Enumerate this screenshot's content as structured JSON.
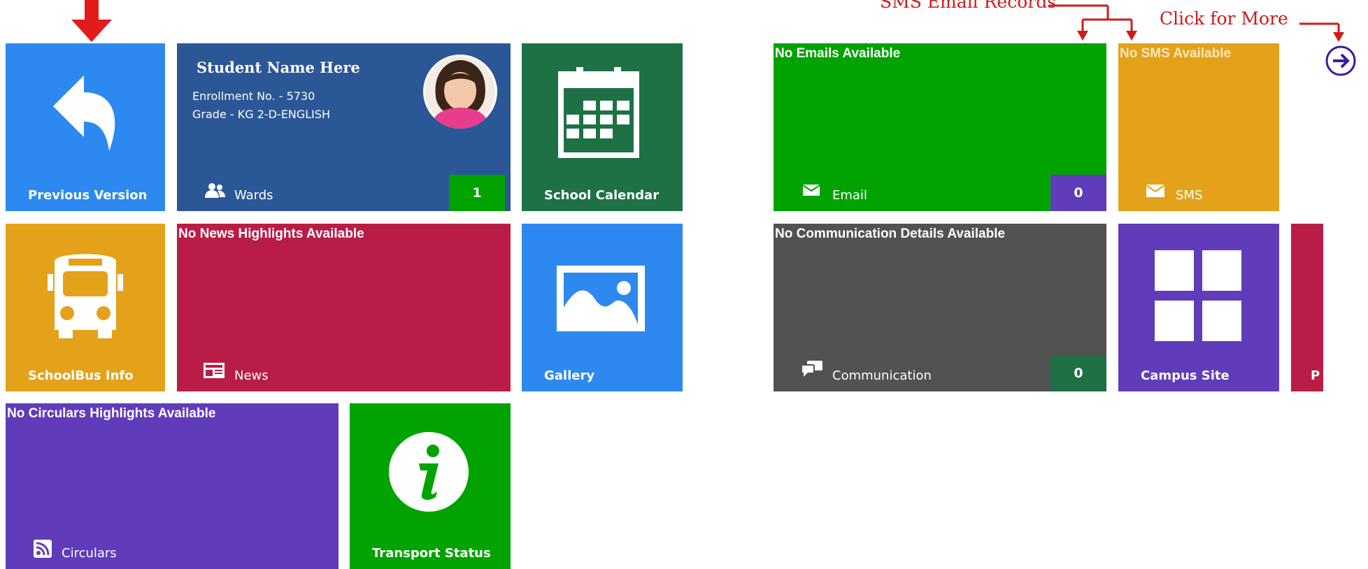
{
  "annotations": {
    "sms_email_records": "SMS Email Records",
    "click_for_more": "Click for More"
  },
  "tiles": {
    "previous_version": {
      "label": "Previous Version",
      "color": "#2d89ef"
    },
    "student": {
      "name": "Student Name Here",
      "enrollment": "Enrollment No. - 5730",
      "grade": "Grade - KG 2-D-ENGLISH",
      "label": "Wards",
      "count": "1",
      "color": "#2b5797"
    },
    "school_calendar": {
      "label": "School Calendar",
      "color": "#1e7145"
    },
    "schoolbus": {
      "label": "SchoolBus Info",
      "color": "#e3a21a"
    },
    "news": {
      "top_text": "No News Highlights Available",
      "label": "News",
      "color": "#b91d47"
    },
    "gallery": {
      "label": "Gallery",
      "color": "#2d89ef"
    },
    "circulars": {
      "top_text": "No Circulars Highlights Available",
      "label": "Circulars",
      "color": "#603cba"
    },
    "transport_status": {
      "label": "Transport Status",
      "color": "#00a300"
    },
    "email": {
      "top_text": "No Emails Available",
      "label": "Email",
      "count": "0",
      "color": "#00a300"
    },
    "sms": {
      "top_text": "No SMS Available",
      "label": "SMS",
      "color": "#e3a21a"
    },
    "communication": {
      "top_text": "No Communication Details Available",
      "label": "Communication",
      "count": "0",
      "color": "#525252"
    },
    "campus_site": {
      "label": "Campus Site",
      "color": "#603cba"
    },
    "partial_tile": {
      "label": "P",
      "color": "#b91d47"
    }
  },
  "icons": {
    "previous_version": "back-arrow-icon",
    "wards": "users-icon",
    "calendar": "calendar-icon",
    "bus": "bus-icon",
    "news": "newspaper-icon",
    "gallery": "picture-icon",
    "circulars": "rss-icon",
    "transport": "info-icon",
    "email": "envelope-icon",
    "sms": "envelope-icon",
    "communication": "chat-icon",
    "campus": "grid-icon",
    "more": "circle-arrow-right-icon"
  },
  "colors": {
    "annotation_red": "#cc1a1a",
    "badge_green": "#00a300",
    "badge_purple": "#603cba",
    "badge_darkgreen": "#1e7145",
    "more_button": "#3b1aa6"
  }
}
